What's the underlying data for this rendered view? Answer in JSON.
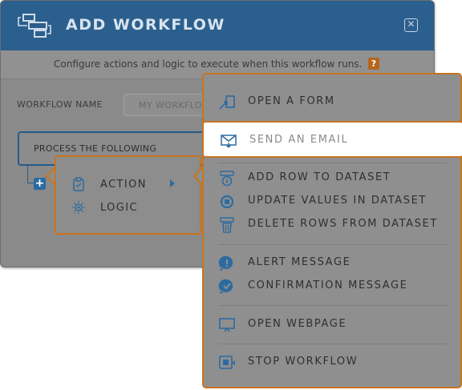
{
  "dialog": {
    "title": "ADD WORKFLOW",
    "close_icon": "close-icon",
    "logo_icon": "workflow-icon",
    "subtitle": "Configure actions and logic to execute when this workflow runs.",
    "help_label": "?",
    "workflow_name_label": "WORKFLOW NAME",
    "workflow_name_placeholder": "MY WORKFLOW",
    "process_label": "PROCESS THE FOLLOWING",
    "add_step_label": "+"
  },
  "mini_menu": {
    "items": [
      {
        "label": "ACTION",
        "icon": "clipboard-icon"
      },
      {
        "label": "LOGIC",
        "icon": "logic-icon"
      }
    ]
  },
  "action_menu": {
    "items": [
      {
        "label": "OPEN A FORM",
        "icon": "form-icon"
      },
      {
        "label": "SEND AN EMAIL",
        "icon": "email-icon",
        "selected": true
      },
      {
        "label": "ADD ROW TO DATASET",
        "icon": "add-row-icon"
      },
      {
        "label": "UPDATE VALUES IN DATASET",
        "icon": "update-icon"
      },
      {
        "label": "DELETE ROWS FROM DATASET",
        "icon": "delete-icon"
      },
      {
        "label": "ALERT MESSAGE",
        "icon": "alert-icon"
      },
      {
        "label": "CONFIRMATION MESSAGE",
        "icon": "confirm-icon"
      },
      {
        "label": "OPEN WEBPAGE",
        "icon": "webpage-icon"
      },
      {
        "label": "STOP WORKFLOW",
        "icon": "stop-icon"
      }
    ]
  },
  "colors": {
    "header": "#2b5f8d",
    "accent": "#c8741f",
    "icon_blue": "#2d6aa0",
    "overlay": "#8f8f8f"
  }
}
